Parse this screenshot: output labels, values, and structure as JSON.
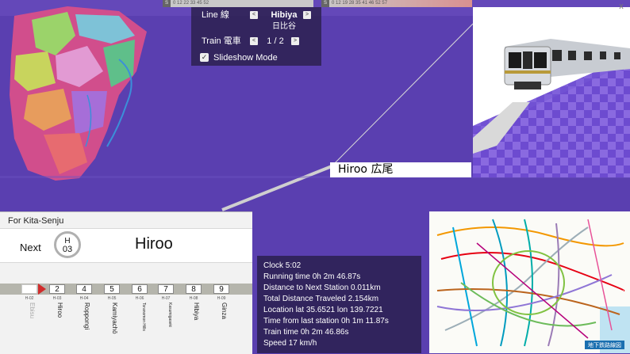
{
  "window": {
    "close_icon": "close-icon",
    "close_glyph": "x"
  },
  "timebars": {
    "left": {
      "tag": "S",
      "ticks": "0 12 22 33 45 52"
    },
    "right": {
      "tag": "S",
      "ticks": "0 12 19 28 35 41 46 52 57"
    }
  },
  "controls": {
    "line_label": "Line 線",
    "line_value": "Hibiya",
    "line_value_jp": "日比谷",
    "train_label": "Train 電車",
    "train_value": "1 / 2",
    "slideshow_label": "Slideshow Mode",
    "slideshow_checked": true,
    "prev_glyph": "<",
    "next_glyph": ">",
    "check_glyph": "✓"
  },
  "station_overlay": {
    "label": "Hiroo 広尾"
  },
  "board": {
    "direction": "For Kita-Senju",
    "next_label": "Next",
    "station_letter": "H",
    "station_number": "03",
    "station_name": "Hiroo",
    "stops": [
      {
        "num": "",
        "code": "H-02",
        "name": "Ebisu",
        "past": true
      },
      {
        "num": "2",
        "code": "H-03",
        "name": "Hiroo",
        "past": false
      },
      {
        "num": "4",
        "code": "H-04",
        "name": "Roppongi",
        "past": false
      },
      {
        "num": "5",
        "code": "H-05",
        "name": "Kamiyachō",
        "past": false
      },
      {
        "num": "6",
        "code": "H-06",
        "name": "Toranomon Hills",
        "past": false
      },
      {
        "num": "7",
        "code": "H-07",
        "name": "Kasumigaseki",
        "past": false
      },
      {
        "num": "8",
        "code": "H-08",
        "name": "Hibiya",
        "past": false
      },
      {
        "num": "9",
        "code": "H-09",
        "name": "Ginza",
        "past": false
      }
    ],
    "line_color": "#b5b5ac",
    "arrow_color": "#d12b2b"
  },
  "info": {
    "clock": "Clock 5:02",
    "running_time": "Running time 0h 2m 46.87s",
    "distance_next": "Distance to Next Station 0.011km",
    "total_distance": "Total Distance Traveled 2.154km",
    "location": "Location lat 35.6521 lon 139.7221",
    "time_from_last": "Time from last station 0h 1m 11.87s",
    "train_time": "Train time 0h 2m 46.86s",
    "speed": "Speed 17 km/h"
  },
  "subway_map": {
    "legend": "地下鉄路線図"
  },
  "colors": {
    "background": "#5a3fb0",
    "grid_dark": "#6d4bd0",
    "grid_light": "#8a6ae0",
    "district_pink": "#d9508e"
  }
}
